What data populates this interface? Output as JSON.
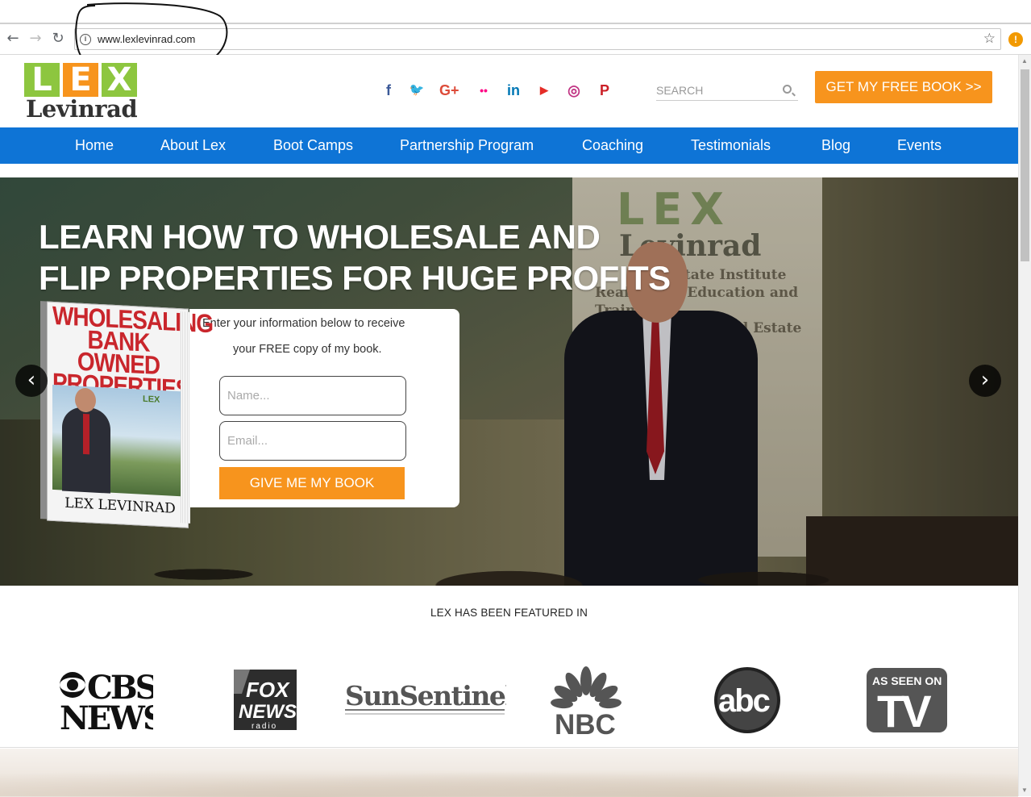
{
  "browser": {
    "url": "www.lexlevinrad.com",
    "alert": "!"
  },
  "logo": {
    "letters": [
      "L",
      "E",
      "X"
    ],
    "letter_colors": [
      "#8dc63f",
      "#f7941d",
      "#8dc63f"
    ],
    "word": "Levinrad"
  },
  "social": [
    {
      "icon": "facebook-icon",
      "glyph": "f",
      "color": "#3b5998"
    },
    {
      "icon": "twitter-icon",
      "glyph": "🐦",
      "color": "#1da1f2"
    },
    {
      "icon": "google-plus-icon",
      "glyph": "G+",
      "color": "#dd4b39"
    },
    {
      "icon": "flickr-icon",
      "glyph": "••",
      "color": "#ff0084"
    },
    {
      "icon": "linkedin-icon",
      "glyph": "in",
      "color": "#0077b5"
    },
    {
      "icon": "youtube-icon",
      "glyph": "▶",
      "color": "#e52d27"
    },
    {
      "icon": "instagram-icon",
      "glyph": "◎",
      "color": "#c13584"
    },
    {
      "icon": "pinterest-icon",
      "glyph": "P",
      "color": "#cb2027"
    },
    {
      "icon": "apple-icon",
      "glyph": "",
      "color": "#5b5bd6"
    }
  ],
  "search": {
    "placeholder": "SEARCH"
  },
  "header_cta": "GET MY FREE BOOK >>",
  "nav": [
    "Home",
    "About Lex",
    "Boot Camps",
    "Partnership Program",
    "Coaching",
    "Testimonials",
    "Blog",
    "Events"
  ],
  "hero": {
    "title_line1": "LEARN HOW TO WHOLESALE AND",
    "title_line2": "FLIP PROPERTIES FOR HUGE PROFITS",
    "banner_lex": "LEX",
    "banner_name": "Levinrad",
    "banner_text1": "Real Estate Institute",
    "banner_text2": "Real Estate Education and Training",
    "banner_text3": "for all levels of Real Estate Investors",
    "book": {
      "title": "WHOLESALING BANK OWNED PROPERTIES",
      "mini_logo": "LEX",
      "author": "LEX LEVINRAD"
    },
    "optin": {
      "text1": "Enter your information below to receive",
      "text2": "your FREE copy of my book.",
      "name_placeholder": "Name...",
      "email_placeholder": "Email...",
      "button": "GIVE ME MY BOOK"
    },
    "prev": "‹",
    "next": "›"
  },
  "featured": {
    "title": "LEX HAS BEEN FEATURED IN",
    "logos": [
      {
        "icon": "cbs-news-logo",
        "line1": "CBS",
        "line2": "NEWS"
      },
      {
        "icon": "fox-news-radio-logo",
        "line1": "FOX",
        "line2": "NEWS",
        "line3": "radio"
      },
      {
        "icon": "sun-sentinel-logo",
        "line1": "SunSentinel"
      },
      {
        "icon": "nbc-logo",
        "line1": "NBC"
      },
      {
        "icon": "abc-logo",
        "line1": "abc"
      },
      {
        "icon": "as-seen-on-tv-logo",
        "line1": "AS SEEN ON",
        "line2": "TV"
      }
    ]
  }
}
